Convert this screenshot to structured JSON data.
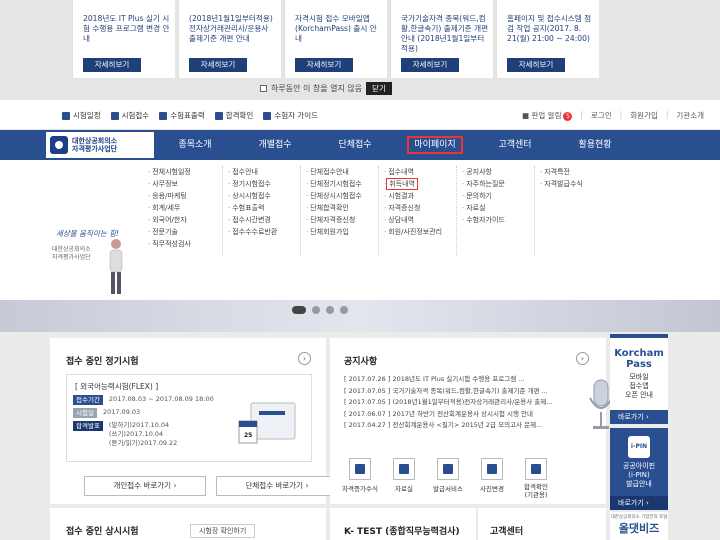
{
  "popup": {
    "cards": [
      {
        "text": "2018년도 IT Plus 실기 시험 수행용 프로그램 변경 안내",
        "button": "자세히보기"
      },
      {
        "text": "(2018년1월1일부터적용)전자상거래관리사/운용사 출제기준 개편 안내",
        "button": "자세히보기"
      },
      {
        "text": "자격시험 접수 모바일앱(KorchamPass) 출시 안내",
        "button": "자세히보기"
      },
      {
        "text": "국가기술자격 종목(워드,컴활,한글속기) 출제기준 개편 안내 (2018년1월1일부터적용)",
        "button": "자세히보기"
      },
      {
        "text": "홈페이지 및 접수시스템 점검 작업 공지(2017. 8. 21(월) 21:00 ~ 24:00)",
        "button": "자세히보기"
      }
    ],
    "no_show_today": "하루동안 이 창을 열지 않음",
    "close_label": "닫기"
  },
  "util": {
    "left": [
      "시험일정",
      "시험접수",
      "수험표출력",
      "합격확인",
      "수험자 가이드"
    ],
    "right_alarm": "알림",
    "right_alarm_prefix": "판업",
    "badge": "5",
    "login": "로그인",
    "join": "회원가입",
    "org": "기관소개"
  },
  "logo": {
    "line1": "대한상공회의소",
    "line2": "자격평가사업단"
  },
  "nav": [
    "종목소개",
    "개별접수",
    "단체접수",
    "마이페이지",
    "고객센터",
    "활용현황"
  ],
  "megamenu": {
    "col1": [
      "전체시험일정",
      "사무정보",
      "응용/마케팅",
      "회계/세무",
      "외국어/한자",
      "전문기술",
      "직무적성검사"
    ],
    "col2": [
      "접수안내",
      "정기시험접수",
      "상시시험접수",
      "수험표출력",
      "접수시간변경",
      "접수수수료반환"
    ],
    "col3": [
      "단체접수안내",
      "단체정기시험접수",
      "단체상시시험접수",
      "단체합격확인",
      "단체자격증신청",
      "단체회원가입"
    ],
    "col4": [
      "접수내역",
      "취득내역",
      "시험결과",
      "자격증신청",
      "상담내역",
      "회원/사진정보관리"
    ],
    "col5": [
      "공지사항",
      "자주하는질문",
      "문의하기",
      "자료실",
      "수험자가이드"
    ],
    "col6": [
      "자격특전",
      "자격발급수식"
    ]
  },
  "mascot": {
    "slogan": "세상을 움직이는 힘!",
    "sub1": "대한상공회의소",
    "sub2": "자격평가사업단"
  },
  "exams": {
    "title": "접수 중인 정기시험",
    "name": "[ 외국어능력시험(FLEX) ]",
    "period_label": "접수기간",
    "period_value": "2017.08.03 ~ 2017.08.09 18:00",
    "exam_label": "시험일",
    "exam_value": "2017.09.03",
    "result_label": "합격발표",
    "result_values": [
      "(말하기)2017.10.04",
      "(쓰기)2017.10.04",
      "(듣기/읽기)2017.09.22"
    ],
    "tablet_date": "25",
    "btn_individual": "개인접수 바로가기",
    "btn_group": "단체접수 바로가기"
  },
  "notice": {
    "title": "공지사항",
    "items": [
      "[ 2017.07.26 ] 2018년도 IT Plus 실기시험 수행용 프로그램 ...",
      "[ 2017.07.05 ] 국가기술자격 종목(워드,컴활,한글속기) 출제기준 개편 ...",
      "[ 2017.07.05 ] (2018년1월1일부터적용)전자상거래관리사/운용사 출제...",
      "[ 2017.06.07 ] 2017년 하반기 전산회계운용사 상시시험 시행 안내",
      "[ 2017.04.27 ] 전산회계운용사 <필기> 2015년 2급 모의고사 문제..."
    ],
    "services": [
      "자격증가수식",
      "자료실",
      "발급서비스",
      "사진변경",
      "합격확인\n(기관용)"
    ]
  },
  "bottom": {
    "left_title": "접수 중인 상시시험",
    "left_link": "시험장 확인하기",
    "mid_title": "K- TEST (종합직무능력검사)",
    "right_title": "고객센터"
  },
  "ads": {
    "ad1_title1": "Korcham",
    "ad1_title2": "Pass",
    "ad1_l1": "모바일",
    "ad1_l2": "접수앱",
    "ad1_l3": "오픈 안내",
    "ad1_btn": "바로가기",
    "ad2_tag": "i-PIN",
    "ad2_l1": "공공아이핀",
    "ad2_l2": "(i-PIN)",
    "ad2_l3": "발급안내",
    "ad2_btn": "바로가기",
    "ad3_small": "대한상공회의소 기업전직 포털",
    "ad3_big": "올댓비즈"
  },
  "colors": {
    "brand": "#2a4f91",
    "highlight": "#e33333"
  }
}
